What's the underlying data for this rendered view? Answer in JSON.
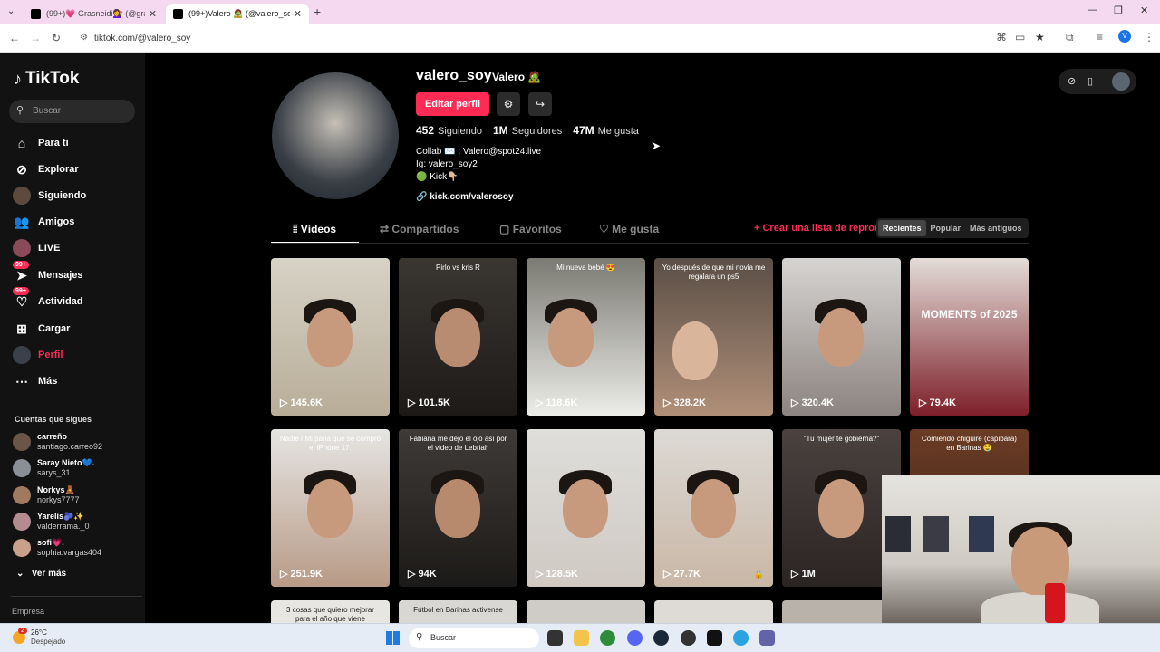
{
  "browser": {
    "tabs": [
      {
        "title": "(99+)💗 Grasneidi💇‍♀️ (@gras60...",
        "active": false
      },
      {
        "title": "(99+)Valero 🧟 (@valero_soy) | T",
        "active": true
      }
    ],
    "url": "tiktok.com/@valero_soy",
    "profile_initial": "V"
  },
  "sidebar": {
    "logo": "TikTok",
    "search_placeholder": "Buscar",
    "items": [
      {
        "label": "Para ti",
        "icon": "home-icon"
      },
      {
        "label": "Explorar",
        "icon": "compass-icon"
      },
      {
        "label": "Siguiendo",
        "icon": "following-avatar-icon"
      },
      {
        "label": "Amigos",
        "icon": "friends-icon"
      },
      {
        "label": "LIVE",
        "icon": "live-avatar-icon"
      },
      {
        "label": "Mensajes",
        "icon": "messages-icon",
        "badge": "99+"
      },
      {
        "label": "Actividad",
        "icon": "activity-icon",
        "badge": "99+"
      },
      {
        "label": "Cargar",
        "icon": "upload-icon"
      },
      {
        "label": "Perfil",
        "icon": "profile-avatar-icon",
        "active": true
      },
      {
        "label": "Más",
        "icon": "more-icon"
      }
    ],
    "following_header": "Cuentas que sigues",
    "following": [
      {
        "name": "carreño",
        "handle": "santiago.carreo92"
      },
      {
        "name": "Saray Nieto💙.",
        "handle": "sarys_31"
      },
      {
        "name": "Norkys🧸",
        "handle": "norkys7777"
      },
      {
        "name": "Yarelis🫐✨",
        "handle": "valderrama._0"
      },
      {
        "name": "sofi💗.",
        "handle": "sophia.vargas404"
      }
    ],
    "see_more": "Ver más",
    "footer": "Empresa"
  },
  "profile": {
    "username": "valero_soy",
    "nickname": "Valero 🧟",
    "edit_button": "Editar perfil",
    "stats": [
      {
        "value": "452",
        "label": "Siguiendo"
      },
      {
        "value": "1M",
        "label": "Seguidores"
      },
      {
        "value": "47M",
        "label": "Me gusta"
      }
    ],
    "bio_lines": [
      "Collab ✉️ : Valero@spot24.live",
      "Ig: valero_soy2",
      "🟢 Kick👇🏼"
    ],
    "link": "kick.com/valerosoy"
  },
  "tabs": [
    {
      "label": "Vídeos",
      "active": true
    },
    {
      "label": "Compartidos"
    },
    {
      "label": "Favoritos"
    },
    {
      "label": "Me gusta"
    }
  ],
  "create_list": "+ Crear una lista de reproducción",
  "sort": [
    "Recientes",
    "Popular",
    "Más antiguos"
  ],
  "videos": [
    {
      "views": "145.6K",
      "caption": ""
    },
    {
      "views": "101.5K",
      "caption": "Pirlo vs kris R"
    },
    {
      "views": "118.6K",
      "caption": "Mi nueva bebé 😍"
    },
    {
      "views": "328.2K",
      "caption": "Yo después de que mi novia me regalara un ps5"
    },
    {
      "views": "320.4K",
      "caption": ""
    },
    {
      "views": "79.4K",
      "caption": "MOMENTS of 2025"
    },
    {
      "views": "251.9K",
      "caption": "Nadie / Mi pana que se compró el iPhone 17:"
    },
    {
      "views": "94K",
      "caption": "Fabiana me dejo el ojo así por el video de Lebriah"
    },
    {
      "views": "128.5K",
      "caption": ""
    },
    {
      "views": "27.7K",
      "caption": ""
    },
    {
      "views": "1M",
      "caption": "\"Tu mujer te gobierna?\""
    },
    {
      "views": "",
      "caption": "Comiendo chiguire (capibara) en Barinas 🤤"
    },
    {
      "views": "",
      "caption": "3 cosas que quiero mejorar para el año que viene"
    },
    {
      "views": "",
      "caption": "Fútbol en Barinas activense"
    }
  ],
  "taskbar": {
    "weather_temp": "26°C",
    "weather_desc": "Despejado",
    "weather_badge": "2",
    "search_placeholder": "Buscar"
  },
  "colors": {
    "accent": "#fe2c55",
    "bg": "#000000",
    "sidebar": "#121212"
  }
}
